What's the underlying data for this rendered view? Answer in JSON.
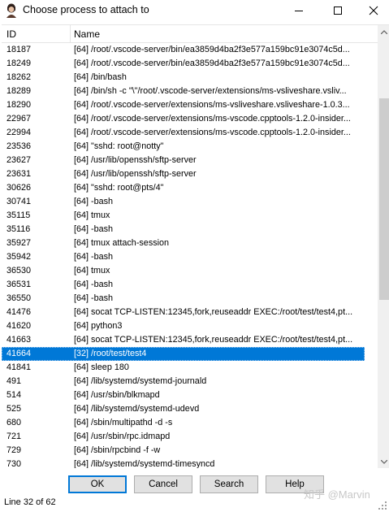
{
  "window": {
    "title": "Choose process to attach to"
  },
  "columns": {
    "id": "ID",
    "name": "Name"
  },
  "rows": [
    {
      "id": "18187",
      "name": "[64] /root/.vscode-server/bin/ea3859d4ba2f3e577a159bc91e3074c5d..."
    },
    {
      "id": "18249",
      "name": "[64] /root/.vscode-server/bin/ea3859d4ba2f3e577a159bc91e3074c5d..."
    },
    {
      "id": "18262",
      "name": "[64] /bin/bash"
    },
    {
      "id": "18289",
      "name": "[64] /bin/sh -c \"\\\"/root/.vscode-server/extensions/ms-vsliveshare.vsliv..."
    },
    {
      "id": "18290",
      "name": "[64] /root/.vscode-server/extensions/ms-vsliveshare.vsliveshare-1.0.3..."
    },
    {
      "id": "22967",
      "name": "[64] /root/.vscode-server/extensions/ms-vscode.cpptools-1.2.0-insider..."
    },
    {
      "id": "22994",
      "name": "[64] /root/.vscode-server/extensions/ms-vscode.cpptools-1.2.0-insider..."
    },
    {
      "id": "23536",
      "name": "[64] \"sshd: root@notty\""
    },
    {
      "id": "23627",
      "name": "[64] /usr/lib/openssh/sftp-server"
    },
    {
      "id": "23631",
      "name": "[64] /usr/lib/openssh/sftp-server"
    },
    {
      "id": "30626",
      "name": "[64] \"sshd: root@pts/4\""
    },
    {
      "id": "30741",
      "name": "[64] -bash"
    },
    {
      "id": "35115",
      "name": "[64] tmux"
    },
    {
      "id": "35116",
      "name": "[64] -bash"
    },
    {
      "id": "35927",
      "name": "[64] tmux attach-session"
    },
    {
      "id": "35942",
      "name": "[64] -bash"
    },
    {
      "id": "36530",
      "name": "[64] tmux"
    },
    {
      "id": "36531",
      "name": "[64] -bash"
    },
    {
      "id": "36550",
      "name": "[64] -bash"
    },
    {
      "id": "41476",
      "name": "[64] socat TCP-LISTEN:12345,fork,reuseaddr EXEC:/root/test/test4,pt..."
    },
    {
      "id": "41620",
      "name": "[64] python3"
    },
    {
      "id": "41663",
      "name": "[64] socat TCP-LISTEN:12345,fork,reuseaddr EXEC:/root/test/test4,pt..."
    },
    {
      "id": "41664",
      "name": "[32] /root/test/test4",
      "selected": true
    },
    {
      "id": "41841",
      "name": "[64] sleep 180"
    },
    {
      "id": "491",
      "name": "[64] /lib/systemd/systemd-journald"
    },
    {
      "id": "514",
      "name": "[64] /usr/sbin/blkmapd"
    },
    {
      "id": "525",
      "name": "[64] /lib/systemd/systemd-udevd"
    },
    {
      "id": "680",
      "name": "[64] /sbin/multipathd -d -s"
    },
    {
      "id": "721",
      "name": "[64] /usr/sbin/rpc.idmapd"
    },
    {
      "id": "729",
      "name": "[64] /sbin/rpcbind -f -w"
    },
    {
      "id": "730",
      "name": "[64] /lib/systemd/systemd-timesyncd"
    }
  ],
  "buttons": {
    "ok": "OK",
    "cancel": "Cancel",
    "search": "Search",
    "help": "Help"
  },
  "status": "Line 32 of 62",
  "watermark": "知乎 @Marvin",
  "colors": {
    "selection": "#0078d7",
    "default_button_border": "#0078d7",
    "button_face": "#e1e1e1"
  },
  "icons": {
    "app": "avatar-icon",
    "minimize": "minimize-icon",
    "maximize": "maximize-icon",
    "close": "close-icon"
  }
}
